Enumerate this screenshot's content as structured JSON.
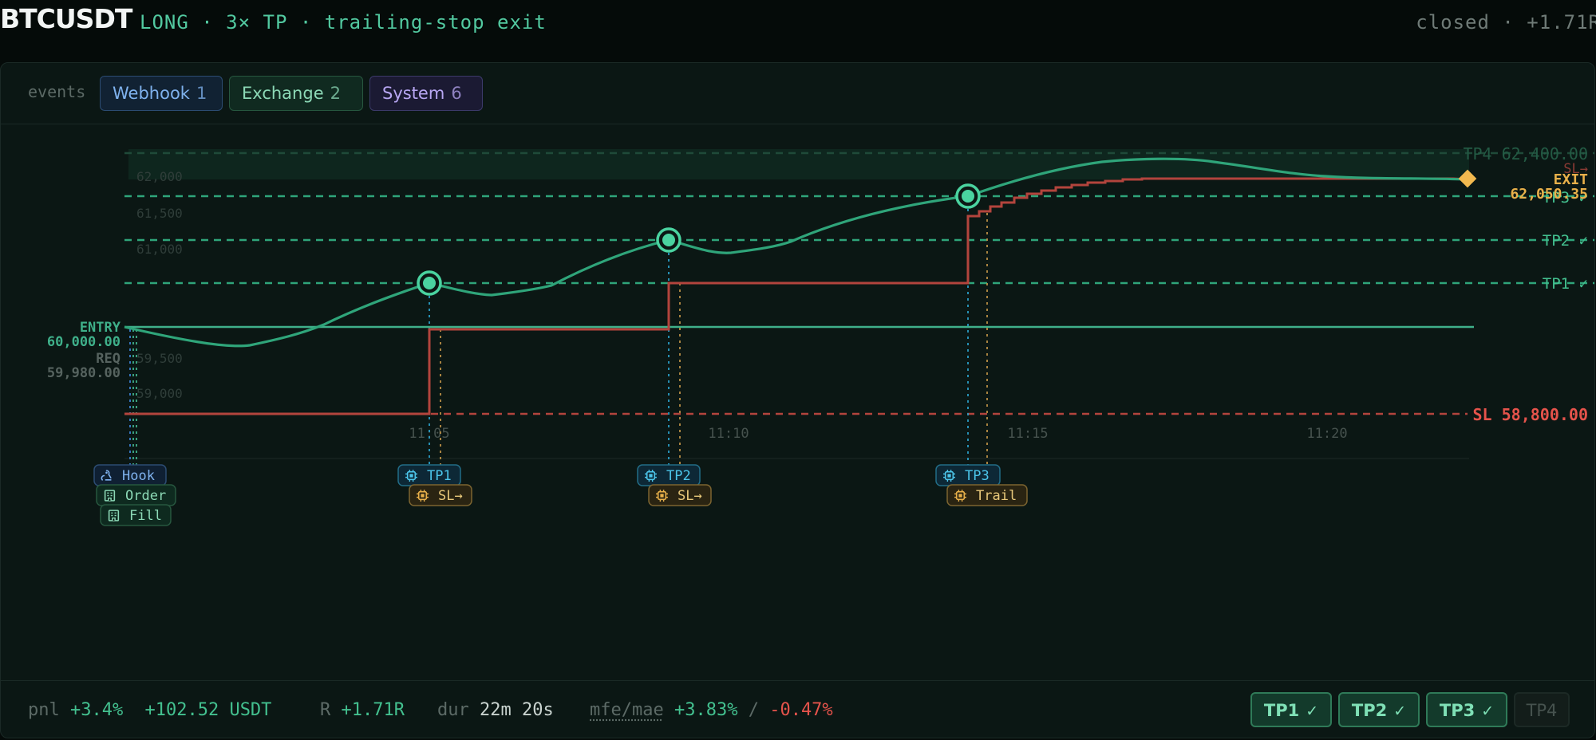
{
  "header": {
    "symbol": "BTCUSDT",
    "subtitle": "LONG · 3× TP · trailing-stop exit",
    "status": "closed · +1.71R"
  },
  "events": {
    "label": "events",
    "filters": [
      {
        "name": "Webhook",
        "count": "1"
      },
      {
        "name": "Exchange",
        "count": "2"
      },
      {
        "name": "System",
        "count": "6"
      }
    ]
  },
  "chart_data": {
    "type": "line",
    "x_ticks": [
      "11:05",
      "11:10",
      "11:15",
      "11:20"
    ],
    "y_ticks": [
      "62,000",
      "61,500",
      "61,000",
      "59,500",
      "59,000"
    ],
    "levels": [
      {
        "label": "TP4 62,400.00"
      },
      {
        "label": "TP3 ✓"
      },
      {
        "label": "TP2 ✓"
      },
      {
        "label": "TP1 ✓"
      },
      {
        "label": "SL 58,800.00"
      }
    ],
    "entry": {
      "label": "ENTRY",
      "value": "60,000.00"
    },
    "req": {
      "label": "REQ",
      "value": "59,980.00"
    },
    "exit": {
      "label": "EXIT",
      "value": "62,050.35",
      "sl_label": "SL→"
    },
    "series": [
      {
        "name": "price",
        "color": "#2fa57a"
      },
      {
        "name": "stop",
        "color": "#b3443d"
      }
    ],
    "markers": [
      {
        "label": "Hook",
        "icon": "webhook-icon"
      },
      {
        "label": "Order",
        "icon": "exchange-icon"
      },
      {
        "label": "Fill",
        "icon": "exchange-icon"
      },
      {
        "label": "TP1",
        "icon": "chip-icon"
      },
      {
        "label": "SL→",
        "icon": "chip-icon"
      },
      {
        "label": "TP2",
        "icon": "chip-icon"
      },
      {
        "label": "SL→",
        "icon": "chip-icon"
      },
      {
        "label": "TP3",
        "icon": "chip-icon"
      },
      {
        "label": "Trail",
        "icon": "chip-icon"
      }
    ]
  },
  "footer": {
    "pnl_label": "pnl",
    "pnl_pct": "+3.4%",
    "pnl_usdt": "+102.52 USDT",
    "r_label": "R",
    "r_value": "+1.71R",
    "dur_label": "dur",
    "dur_value": "22m 20s",
    "mfe_label": "mfe/mae",
    "mfe_value": "+3.83%",
    "slash": "/",
    "mae_value": "-0.47%",
    "tp_badges": [
      {
        "label": "TP1",
        "check": "✓"
      },
      {
        "label": "TP2",
        "check": "✓"
      },
      {
        "label": "TP3",
        "check": "✓"
      },
      {
        "label": "TP4",
        "check": ""
      }
    ]
  }
}
